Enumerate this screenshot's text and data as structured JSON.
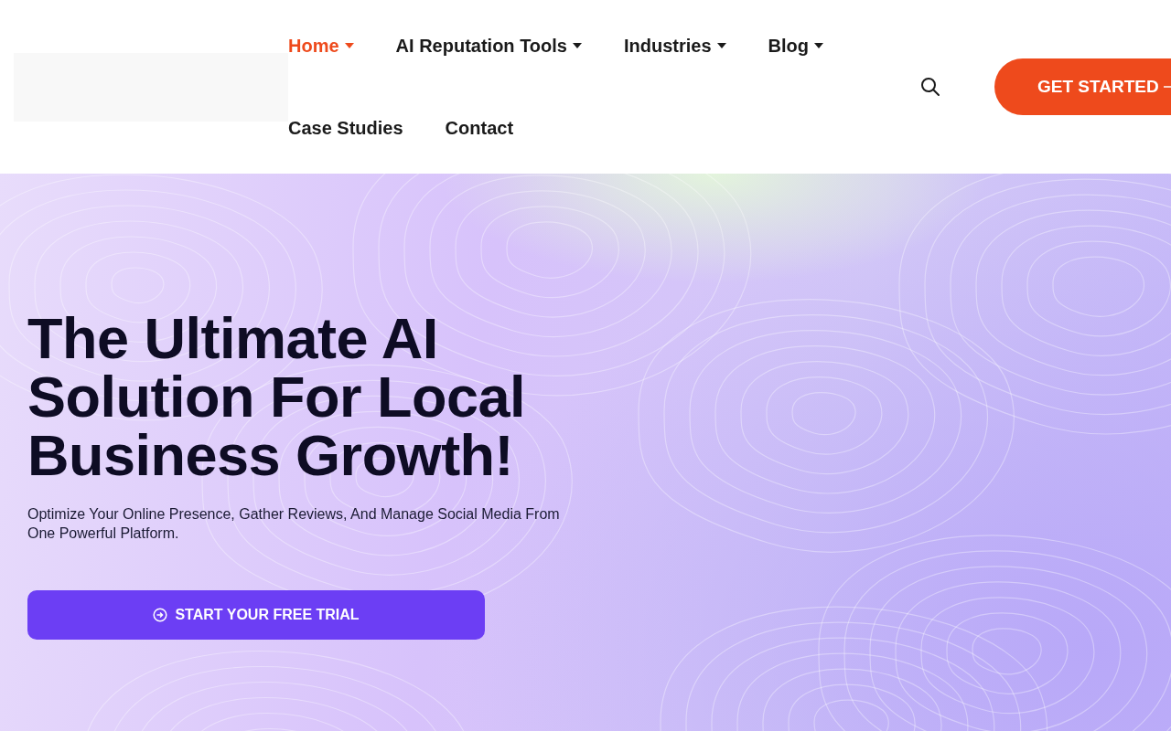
{
  "header": {
    "nav": [
      {
        "label": "Home",
        "selected": true,
        "has_dropdown": true
      },
      {
        "label": "AI Reputation Tools",
        "selected": false,
        "has_dropdown": true
      },
      {
        "label": "Industries",
        "selected": false,
        "has_dropdown": true
      },
      {
        "label": "Blog",
        "selected": false,
        "has_dropdown": true
      },
      {
        "label": "Case Studies",
        "selected": false,
        "has_dropdown": false
      },
      {
        "label": "Contact",
        "selected": false,
        "has_dropdown": false
      }
    ],
    "cta": {
      "label": "GET STARTED"
    }
  },
  "hero": {
    "title": "The Ultimate AI Solution For Local Business Growth!",
    "subtitle": "Optimize Your Online Presence, Gather Reviews, And Manage Social Media From One Powerful Platform.",
    "button": {
      "label": "START YOUR FREE TRIAL"
    }
  }
}
